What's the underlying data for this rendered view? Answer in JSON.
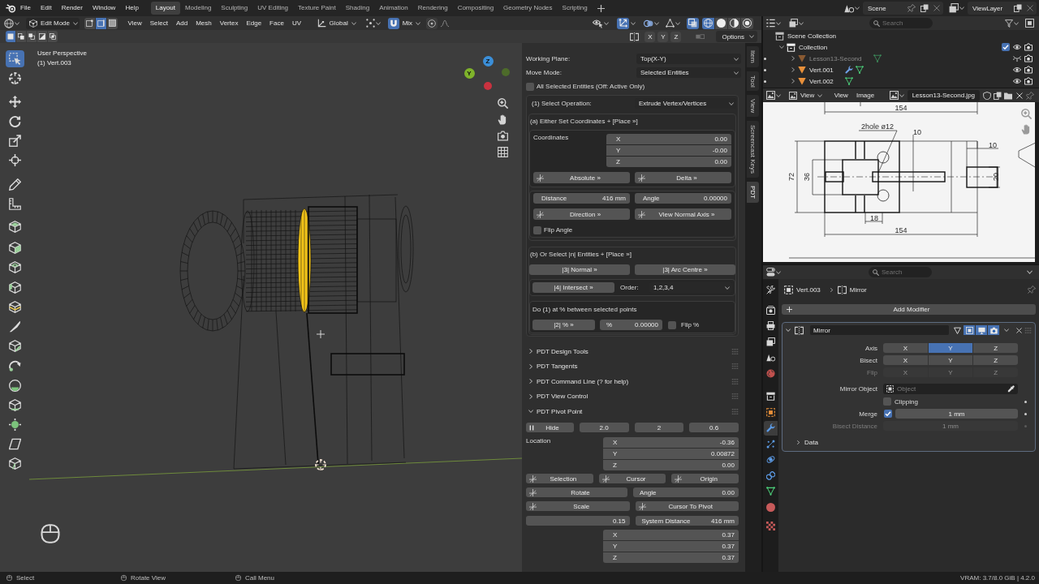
{
  "top_bar": {
    "menus": [
      "File",
      "Edit",
      "Render",
      "Window",
      "Help"
    ],
    "workspaces": [
      {
        "label": "Layout",
        "selected": true
      },
      {
        "label": "Modeling",
        "selected": false
      },
      {
        "label": "Sculpting",
        "selected": false
      },
      {
        "label": "UV Editing",
        "selected": false
      },
      {
        "label": "Texture Paint",
        "selected": false
      },
      {
        "label": "Shading",
        "selected": false
      },
      {
        "label": "Animation",
        "selected": false
      },
      {
        "label": "Rendering",
        "selected": false
      },
      {
        "label": "Compositing",
        "selected": false
      },
      {
        "label": "Geometry Nodes",
        "selected": false
      },
      {
        "label": "Scripting",
        "selected": false
      }
    ],
    "scene": "Scene",
    "view_layer": "ViewLayer"
  },
  "viewport": {
    "header": {
      "mode": "Edit Mode",
      "select_modes": [
        {
          "selected": false
        },
        {
          "selected": true
        },
        {
          "selected": false
        }
      ],
      "menus": [
        "View",
        "Select",
        "Add",
        "Mesh",
        "Vertex",
        "Edge",
        "Face",
        "UV"
      ],
      "orientation": "Global",
      "snap": {
        "on": true,
        "target": "Mix"
      },
      "proportional_editing": {
        "on": false
      },
      "gizmos": {
        "on": true
      },
      "xray": {
        "on": true
      },
      "shading": [
        {
          "selected": true
        },
        {
          "selected": false
        },
        {
          "selected": false
        },
        {
          "selected": false
        }
      ]
    },
    "tool_settings": {
      "box_modes": [
        {
          "selected": true
        },
        {
          "selected": false
        },
        {
          "selected": false
        },
        {
          "selected": false
        },
        {
          "selected": false
        }
      ],
      "mirror_axes": [
        {
          "label": "X",
          "selected": false
        },
        {
          "label": "Y",
          "selected": false
        },
        {
          "label": "Z",
          "selected": false
        }
      ],
      "options": "Options"
    },
    "toolbar": [
      {
        "selected": true
      },
      {
        "selected": false
      },
      {
        "selected": false
      },
      {
        "selected": false
      },
      {
        "selected": false
      },
      {
        "selected": false
      },
      {
        "selected": false
      },
      {
        "selected": false
      },
      {
        "selected": false
      },
      {
        "selected": false
      },
      {
        "selected": false
      },
      {
        "selected": false
      },
      {
        "selected": false
      },
      {
        "selected": false
      },
      {
        "selected": false
      },
      {
        "selected": false
      },
      {
        "selected": false
      },
      {
        "selected": false
      },
      {
        "selected": false
      },
      {
        "selected": false
      },
      {
        "selected": false
      }
    ],
    "overlay": {
      "view_name": "User Perspective",
      "object_info": "(1) Vert.003"
    },
    "gizmo_axes": [
      "Z",
      "Y"
    ],
    "sidebar_tabs": [
      {
        "label": "Item",
        "selected": false
      },
      {
        "label": "Tool",
        "selected": false
      },
      {
        "label": "View",
        "selected": false
      },
      {
        "label": "Screencast Keys",
        "selected": false
      },
      {
        "label": "PDT",
        "selected": true
      }
    ]
  },
  "pdt": {
    "working_plane": {
      "label": "Working Plane:",
      "value": "Top(X-Y)"
    },
    "move_mode": {
      "label": "Move Mode:",
      "value": "Selected Entities"
    },
    "all_selected": {
      "label": "All Selected Entities (Off: Active Only)",
      "checked": false
    },
    "operation": {
      "label": "(1) Select Operation:",
      "value": "Extrude Vertex/Vertices"
    },
    "section_a": {
      "title": "(a) Either Set Coordinates + [Place »]",
      "coordinates_label": "Coordinates",
      "coordinates": [
        {
          "axis": "X",
          "value": "0.00"
        },
        {
          "axis": "Y",
          "value": "-0.00"
        },
        {
          "axis": "Z",
          "value": "0.00"
        }
      ],
      "place_buttons": [
        "Absolute »",
        "Delta »"
      ],
      "distance": {
        "label": "Distance",
        "value": "416 mm"
      },
      "angle": {
        "label": "Angle",
        "value": "0.00000"
      },
      "direction_buttons": [
        "Direction »",
        "View Normal Axis »"
      ],
      "flip_angle": {
        "label": "Flip Angle",
        "checked": false
      }
    },
    "section_b": {
      "title": "(b) Or Select |n| Entities + [Place »]",
      "buttons": [
        "|3| Normal »",
        "|3| Arc Centre »"
      ],
      "intersect": "|4| Intersect »",
      "order": {
        "label": "Order:",
        "value": "1,2,3,4"
      },
      "percent_title": "Do (1) at % between selected points",
      "percent_button": "|2| % »",
      "percent": {
        "label": "%",
        "value": "0.00000"
      },
      "flip_percent": {
        "label": "Flip %",
        "checked": false
      }
    },
    "panels": [
      {
        "title": "PDT Design Tools",
        "expanded": false
      },
      {
        "title": "PDT Tangents",
        "expanded": false
      },
      {
        "title": "PDT Command Line (? for help)",
        "expanded": false
      },
      {
        "title": "PDT View Control",
        "expanded": false
      },
      {
        "title": "PDT Pivot Point",
        "expanded": true,
        "content": {
          "hide": "Hide",
          "values": [
            "2.0",
            "2",
            "0.6"
          ],
          "location_label": "Location",
          "location": [
            {
              "axis": "X",
              "value": "-0.36"
            },
            {
              "axis": "Y",
              "value": "0.00872"
            },
            {
              "axis": "Z",
              "value": "0.00"
            }
          ],
          "pivot_buttons": [
            "Selection",
            "Cursor",
            "Origin"
          ],
          "rotate": "Rotate",
          "angle": {
            "label": "Angle",
            "value": "0.00"
          },
          "scale": "Scale",
          "cursor_to_pivot": "Cursor To Pivot",
          "factor": "0.15",
          "system_distance": {
            "label": "System Distance",
            "value": "416 mm"
          },
          "scale_values": [
            {
              "axis": "X",
              "value": "0.37"
            },
            {
              "axis": "Y",
              "value": "0.37"
            },
            {
              "axis": "Z",
              "value": "0.37"
            }
          ]
        }
      }
    ]
  },
  "outliner": {
    "search": {
      "placeholder": "Search"
    },
    "tree": [
      {
        "label": "Scene Collection",
        "kind": "scene",
        "children": [
          {
            "label": "Collection",
            "kind": "collection",
            "expanded": true,
            "checked": true,
            "children": [
              {
                "label": "Lesson13-Second",
                "kind": "object",
                "expanded": false,
                "hidden": true,
                "modifier": false
              },
              {
                "label": "Vert.001",
                "kind": "object",
                "expanded": false,
                "hidden": false,
                "modifier": true
              },
              {
                "label": "Vert.002",
                "kind": "object",
                "expanded": false,
                "hidden": false,
                "modifier": false
              }
            ]
          }
        ]
      }
    ]
  },
  "image_editor": {
    "view_mode": "View",
    "menus": [
      "View",
      "Image"
    ],
    "image_name": "Lesson13-Second.jpg",
    "drawing_labels": [
      "154",
      "2hole ø12",
      "10",
      "10",
      "72",
      "36",
      "20",
      "18",
      "154"
    ]
  },
  "properties": {
    "search": {
      "placeholder": "Search"
    },
    "tabs": [
      {
        "selected": false
      },
      {
        "selected": false
      },
      {
        "selected": false
      },
      {
        "selected": false
      },
      {
        "selected": false
      },
      {
        "selected": false
      },
      {
        "selected": false
      },
      {
        "selected": false
      },
      {
        "selected": true
      },
      {
        "selected": false
      },
      {
        "selected": false
      },
      {
        "selected": false
      },
      {
        "selected": false
      },
      {
        "selected": false
      },
      {
        "selected": false
      }
    ],
    "breadcrumb": [
      "Vert.003",
      "Mirror"
    ],
    "add_modifier": "Add Modifier",
    "modifier": {
      "name": "Mirror",
      "expanded": true,
      "toggles": [
        {
          "on": false
        },
        {
          "on": true
        },
        {
          "on": true
        },
        {
          "on": true
        }
      ],
      "axis_rows": [
        {
          "label": "Axis",
          "disabled": false,
          "options": [
            {
              "label": "X",
              "selected": false
            },
            {
              "label": "Y",
              "selected": true
            },
            {
              "label": "Z",
              "selected": false
            }
          ]
        },
        {
          "label": "Bisect",
          "disabled": false,
          "options": [
            {
              "label": "X",
              "selected": false
            },
            {
              "label": "Y",
              "selected": false
            },
            {
              "label": "Z",
              "selected": false
            }
          ]
        },
        {
          "label": "Flip",
          "disabled": true,
          "options": [
            {
              "label": "X",
              "selected": false
            },
            {
              "label": "Y",
              "selected": false
            },
            {
              "label": "Z",
              "selected": false
            }
          ]
        }
      ],
      "mirror_object": {
        "label": "Mirror Object",
        "placeholder": "Object"
      },
      "clipping": {
        "label": "Clipping",
        "checked": false
      },
      "merge": {
        "label": "Merge",
        "checked": true,
        "value": "1 mm"
      },
      "bisect_distance": {
        "label": "Bisect Distance",
        "value": "1 mm",
        "disabled": true
      },
      "data": {
        "label": "Data",
        "expanded": false
      }
    }
  },
  "status_bar": {
    "hints": [
      "Select",
      "Rotate View",
      "Call Menu"
    ],
    "info": "VRAM: 3.7/8.0 GiB | 4.2.0"
  }
}
